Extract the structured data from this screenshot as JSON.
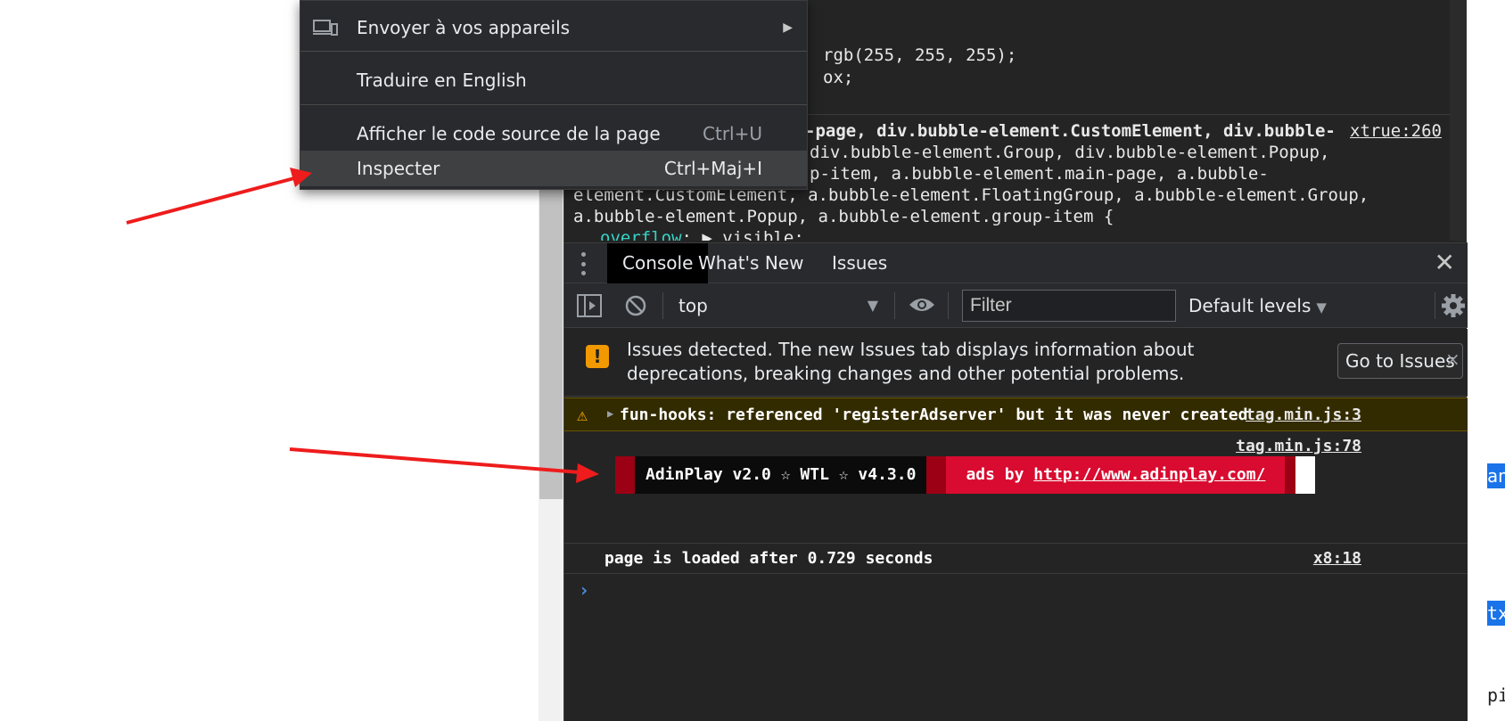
{
  "context_menu": {
    "items": [
      {
        "label": "Envoyer à vos appareils",
        "shortcut": "",
        "submenu_glyph": "▶",
        "icon": "devices-icon"
      },
      {
        "label": "Traduire en English",
        "shortcut": ""
      },
      {
        "label": "Afficher le code source de la page",
        "shortcut": "Ctrl+U"
      },
      {
        "label": "Inspecter",
        "shortcut": "Ctrl+Maj+I"
      }
    ]
  },
  "styles_panel": {
    "lines": [
      "rgb(255, 255, 255);",
      "ox;",
      "-page, div.bubble-element.CustomElement, div.bubble-",
      "div.bubble-element.Group, div.bubble-element.Popup,",
      "p-item, a.bubble-element.main-page, a.bubble-",
      "element.CustomElement, a.bubble-element.FloatingGroup, a.bubble-element.Group,",
      "a.bubble-element.Popup, a.bubble-element.group-item {",
      "overflow",
      ": ▶ visible;"
    ],
    "source_link": "xtrue:260"
  },
  "drawer": {
    "kebab_glyph": "⋮",
    "tabs": [
      {
        "label": "Console",
        "active": true
      },
      {
        "label": "What's New",
        "active": false
      },
      {
        "label": "Issues",
        "active": false
      }
    ],
    "close_glyph": "✕"
  },
  "toolbar": {
    "context": "top",
    "context_arrow": "▼",
    "filter_placeholder": "Filter",
    "levels_label": "Default levels",
    "levels_arrow": "▼"
  },
  "issues_banner": {
    "icon_glyph": "!",
    "text": "Issues detected. The new Issues tab displays information about deprecations, breaking changes and other potential problems.",
    "button": "Go to Issues",
    "close_glyph": "×"
  },
  "console": {
    "warning": {
      "icon_glyph": "⚠",
      "expand_glyph": "▶",
      "text": "fun-hooks: referenced 'registerAdserver' but it was never created",
      "source": "tag.min.js:3"
    },
    "adinplay": {
      "source": "tag.min.js:78",
      "black_text": "AdinPlay v2.0 ☆ WTL ☆ v4.3.0",
      "red_prefix": "ads by ",
      "url": "http://www.adinplay.com/"
    },
    "loaded": {
      "text": "page is loaded after 0.729 seconds",
      "source": "x8:18"
    },
    "prompt_glyph": "›"
  },
  "right_page": {
    "fragments": [
      "an",
      "tx",
      "pi"
    ]
  },
  "colors": {
    "annotation_arrow": "#ee1c1c",
    "devtools_bg": "#242424",
    "ad_red": "#d90b30",
    "ad_dark_red": "#9b0014",
    "warning_bg": "#332b00"
  }
}
